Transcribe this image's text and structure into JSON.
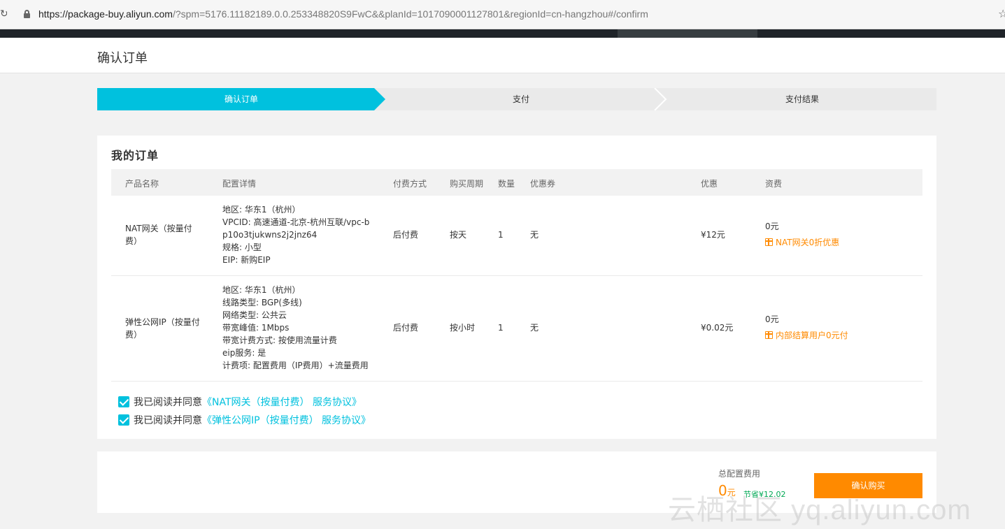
{
  "browser": {
    "url_host": "https://package-buy.aliyun.com",
    "url_rest": "/?spm=5176.11182189.0.0.253348820S9FwC&&planId=1017090001127801&regionId=cn-hangzhou#/confirm"
  },
  "page": {
    "title": "确认订单"
  },
  "steps": [
    "确认订单",
    "支付",
    "支付结果"
  ],
  "order": {
    "title": "我的订单",
    "columns": {
      "product": "产品名称",
      "details": "配置详情",
      "pay_method": "付费方式",
      "period": "购买周期",
      "qty": "数量",
      "coupon": "优惠券",
      "discount": "优惠",
      "fee": "资费"
    },
    "rows": [
      {
        "product": "NAT网关（按量付费）",
        "details": [
          "地区:   华东1（杭州）",
          "VPCID:   高速通道-北京-杭州互联/vpc-b",
          "p10o3tjukwns2j2jnz64",
          "规格:   小型",
          "EIP:   新购EIP"
        ],
        "pay_method": "后付费",
        "period": "按天",
        "qty": "1",
        "coupon": "无",
        "discount": "¥12元",
        "fee": "0元",
        "promo": "NAT网关0折优惠"
      },
      {
        "product": "弹性公网IP（按量付费）",
        "details": [
          "地区:   华东1（杭州）",
          "线路类型:   BGP(多线)",
          "网络类型:   公共云",
          "带宽峰值:   1Mbps",
          "带宽计费方式:   按使用流量计费",
          "eip服务:   是",
          "计费项:   配置费用（IP费用）+流量费用"
        ],
        "pay_method": "后付费",
        "period": "按小时",
        "qty": "1",
        "coupon": "无",
        "discount": "¥0.02元",
        "fee": "0元",
        "promo": "内部结算用户0元付"
      }
    ],
    "agreements": [
      {
        "prefix": "我已阅读并同意",
        "link": "《NAT网关（按量付费） 服务协议》",
        "checked": true
      },
      {
        "prefix": "我已阅读并同意",
        "link": "《弹性公网IP（按量付费） 服务协议》",
        "checked": true
      }
    ]
  },
  "summary": {
    "total_label": "总配置费用",
    "total_value": "0",
    "total_unit": "元",
    "saved": "节省¥12.02",
    "buy_button": "确认购买"
  },
  "watermark": "云栖社区 yq.aliyun.com",
  "colors": {
    "accent": "#00c1de",
    "orange": "#ff8a00",
    "green": "#00a854"
  }
}
